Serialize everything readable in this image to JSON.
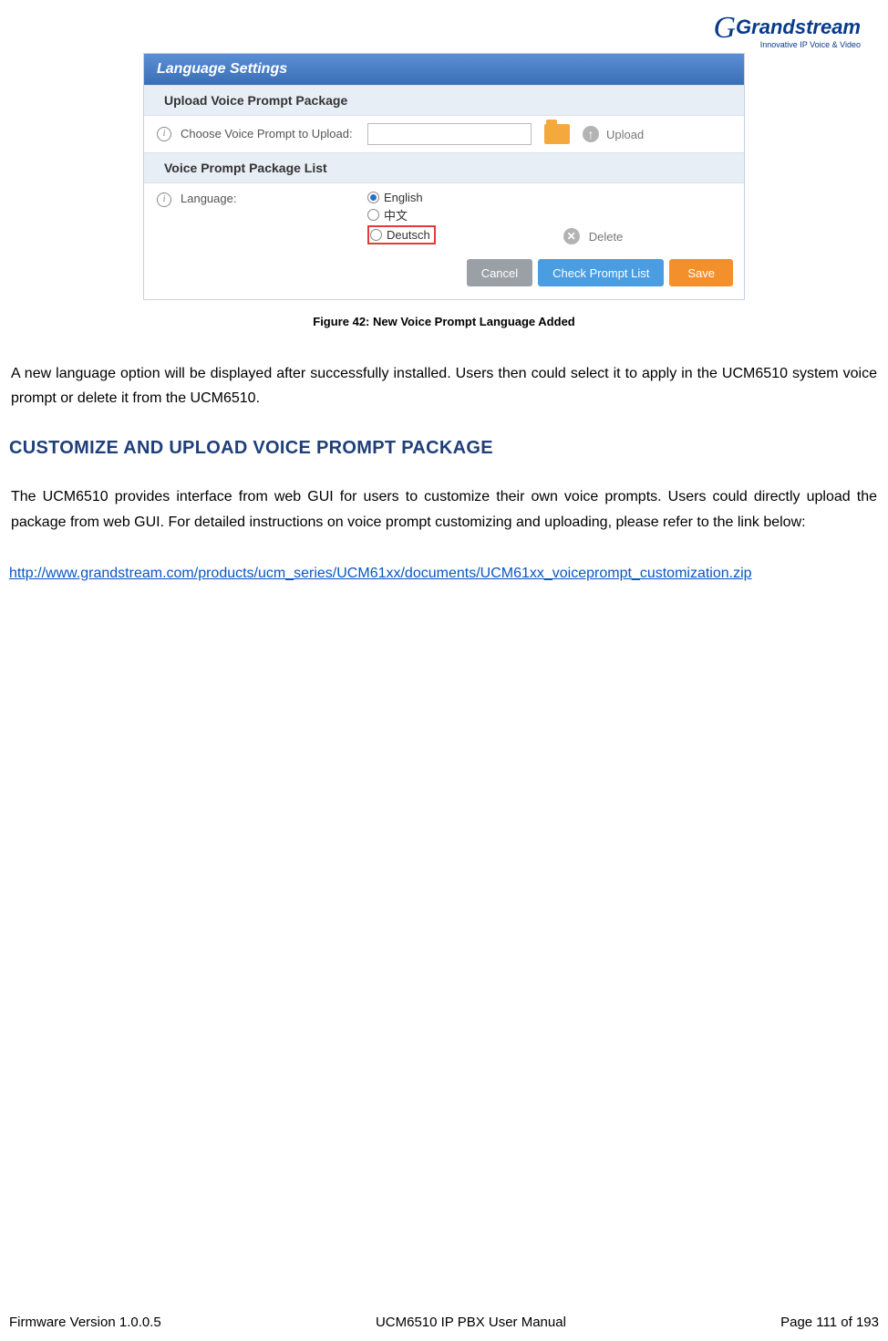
{
  "logo": {
    "name": "Grandstream",
    "sub": "Innovative IP Voice & Video"
  },
  "panel": {
    "title": "Language Settings",
    "upload_section": "Upload Voice Prompt Package",
    "upload_row": {
      "label": "Choose Voice Prompt to Upload:",
      "upload_btn": "Upload"
    },
    "list_section": "Voice Prompt Package List",
    "lang_row": {
      "label": "Language:",
      "options": [
        {
          "label": "English",
          "checked": true,
          "highlight": false
        },
        {
          "label": "中文",
          "checked": false,
          "highlight": false
        },
        {
          "label": "Deutsch",
          "checked": false,
          "highlight": true
        }
      ],
      "delete_btn": "Delete"
    },
    "buttons": {
      "cancel": "Cancel",
      "check": "Check Prompt List",
      "save": "Save"
    }
  },
  "caption": "Figure 42: New Voice Prompt Language Added",
  "para1": "A new language option will be displayed after successfully installed. Users then could select it to apply in the UCM6510 system voice prompt or delete it from the UCM6510.",
  "section_title": "CUSTOMIZE AND UPLOAD VOICE PROMPT PACKAGE",
  "para2": "The UCM6510 provides interface from web GUI for users to customize their own voice prompts. Users could directly upload the package from web GUI. For detailed instructions on voice prompt customizing and uploading, please refer to the link below:",
  "link": "http://www.grandstream.com/products/ucm_series/UCM61xx/documents/UCM61xx_voiceprompt_customization.zip",
  "footer": {
    "left": "Firmware Version 1.0.0.5",
    "center": "UCM6510 IP PBX User Manual",
    "right": "Page 111 of 193"
  }
}
